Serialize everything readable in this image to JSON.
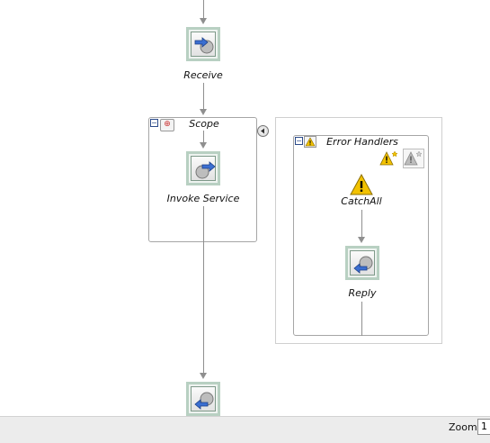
{
  "nodes": {
    "receive": "Receive",
    "scope": "Scope",
    "invoke": "Invoke Service",
    "error_handlers": "Error Handlers",
    "catch_all": "CatchAll",
    "reply": "Reply"
  },
  "statusbar": {
    "zoom_label": "Zoom:",
    "zoom_value": "1"
  },
  "colors": {
    "connector": "#8f8f8f",
    "warning": "#f2c200",
    "activity_border": "#b8d0c2"
  }
}
